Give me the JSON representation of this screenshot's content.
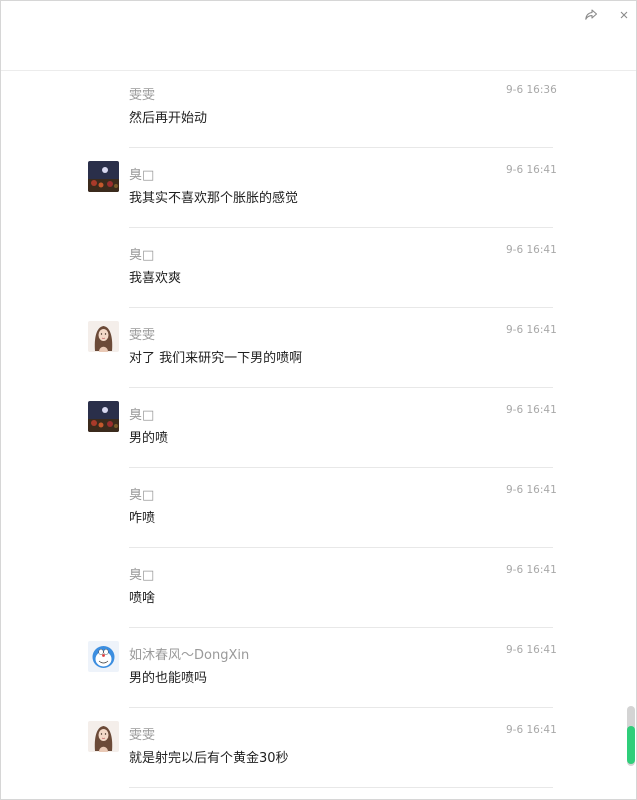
{
  "titlebar": {
    "share_icon": "share-icon",
    "close_icon": "close-icon"
  },
  "messages": [
    {
      "sender": "雯雯",
      "time": "9-6 16:36",
      "text": "然后再开始动",
      "avatar": "none"
    },
    {
      "sender": "臭□",
      "time": "9-6 16:41",
      "text": "我其实不喜欢那个胀胀的感觉",
      "avatar": "night-avatar"
    },
    {
      "sender": "臭□",
      "time": "9-6 16:41",
      "text": "我喜欢爽",
      "avatar": "none"
    },
    {
      "sender": "雯雯",
      "time": "9-6 16:41",
      "text": "对了 我们来研究一下男的喷啊",
      "avatar": "girl-avatar"
    },
    {
      "sender": "臭□",
      "time": "9-6 16:41",
      "text": "男的喷",
      "avatar": "night-avatar"
    },
    {
      "sender": "臭□",
      "time": "9-6 16:41",
      "text": "咋喷",
      "avatar": "none"
    },
    {
      "sender": "臭□",
      "time": "9-6 16:41",
      "text": "喷啥",
      "avatar": "none"
    },
    {
      "sender": "如沐春风～DongXin",
      "time": "9-6 16:41",
      "text": "男的也能喷吗",
      "avatar": "doraemon-avatar"
    },
    {
      "sender": "雯雯",
      "time": "9-6 16:41",
      "text": "就是射完以后有个黄金30秒",
      "avatar": "girl-avatar"
    }
  ],
  "colors": {
    "scroll_accent": "#2fce7a",
    "sender_text": "#9a9a9a",
    "time_text": "#a8a8a8"
  }
}
